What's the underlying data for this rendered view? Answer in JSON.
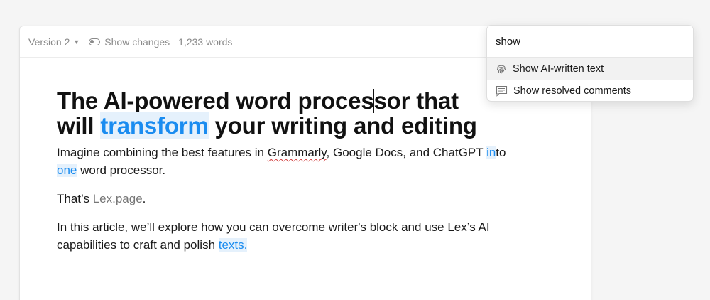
{
  "toolbar": {
    "version_label": "Version 2",
    "show_changes_label": "Show changes",
    "word_count": "1,233 words"
  },
  "document": {
    "title_line1_part1": "The AI-powered word proces",
    "title_line1_part2": "sor that",
    "title_line2_part1": "will ",
    "title_line2_ai": "transform",
    "title_line2_part2": " your writing and editing",
    "p1_part1": "Imagine combining the best features in ",
    "p1_spell": "Grammarly",
    "p1_part2": ", Google Docs, and ChatGPT ",
    "p1_ai1": "in",
    "p1_part3": "to ",
    "p1_ai2": "one",
    "p1_part4": " word processor.",
    "p2_part1": "That’s ",
    "p2_link": "Lex.page",
    "p2_part2": ".",
    "p3_part1": "In this article, we’ll explore how you can overcome writer's block and use Lex’s AI capabilities to craft and polish ",
    "p3_ai": "texts."
  },
  "command_palette": {
    "query": "show",
    "items": [
      {
        "label": "Show AI-written text",
        "icon": "fingerprint-icon",
        "active": true
      },
      {
        "label": "Show resolved comments",
        "icon": "comment-icon",
        "active": false
      }
    ]
  },
  "colors": {
    "ai_highlight_text": "#1a8cf0",
    "ai_highlight_bg": "#e5f1fc",
    "spelling_underline": "#d23b3b"
  }
}
